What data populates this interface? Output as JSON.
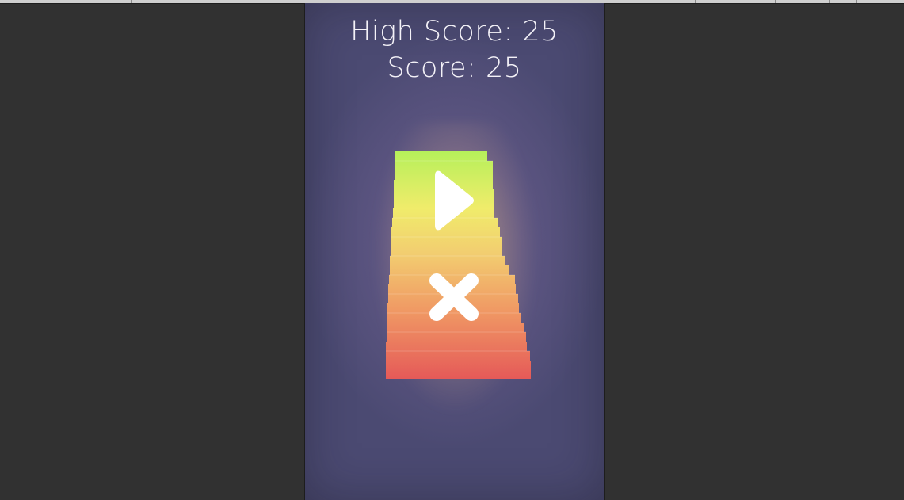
{
  "hud": {
    "high_score_label": "High Score: 25",
    "score_label": "Score: 25",
    "high_score": 25,
    "score": 25
  },
  "controls": {
    "play_icon": "play-icon",
    "close_icon": "close-icon"
  },
  "colors": {
    "editor_background": "#313131",
    "game_background": "#4b4a72",
    "tower_top": "#b6f05a",
    "tower_middle": "#f0ec6b",
    "tower_bottom": "#e55a58",
    "icon": "#ffffff"
  }
}
